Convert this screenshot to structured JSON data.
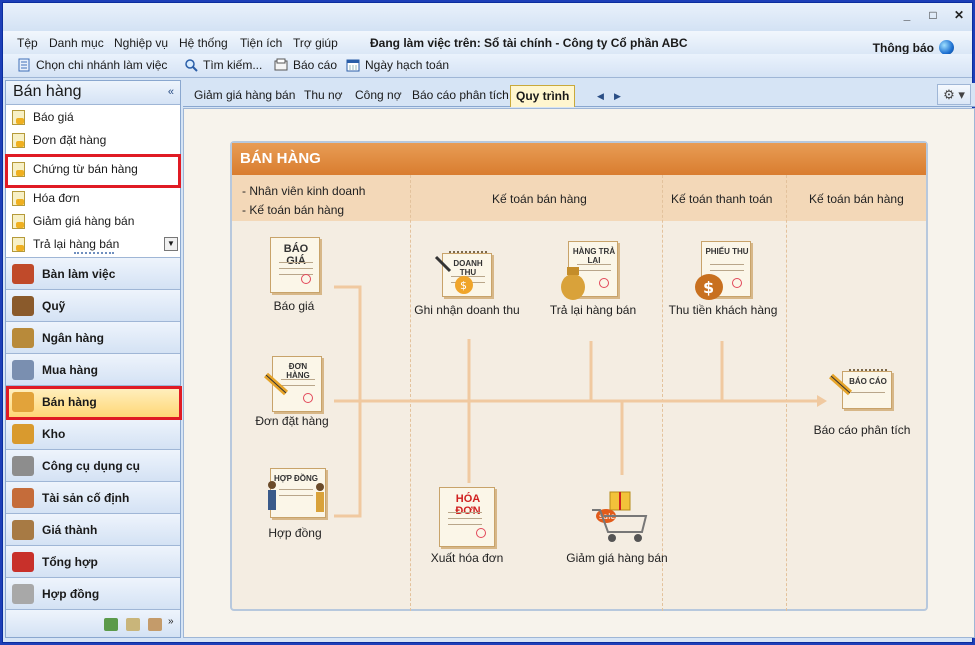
{
  "menu": {
    "items": [
      "Tệp",
      "Danh mục",
      "Nghiệp vụ",
      "Hệ thống",
      "Tiện ích",
      "Trợ giúp"
    ],
    "working_on": "Đang làm việc trên: Sổ tài chính - Công ty Cổ phần ABC",
    "notify": "Thông báo"
  },
  "toolbar": {
    "branch": "Chọn chi nhánh làm việc",
    "search": "Tìm kiếm...",
    "report": "Báo cáo",
    "posting_date": "Ngày hạch toán"
  },
  "sidebar": {
    "title": "Bán hàng",
    "collapse": "«",
    "items": [
      "Báo giá",
      "Đơn đặt hàng",
      "Chứng từ bán hàng",
      "Hóa đơn",
      "Giảm giá hàng bán",
      "Trả lại hàng bán"
    ],
    "modules": [
      "Bàn làm việc",
      "Quỹ",
      "Ngân hàng",
      "Mua hàng",
      "Bán hàng",
      "Kho",
      "Công cụ dụng cụ",
      "Tài sản cố định",
      "Giá thành",
      "Tổng hợp",
      "Hợp đồng"
    ],
    "active_module": "Bán hàng"
  },
  "tabs": [
    "Giảm giá hàng bán",
    "Thu nợ",
    "Công nợ",
    "Báo cáo phân tích",
    "Quy trình"
  ],
  "active_tab": "Quy trình",
  "process": {
    "title": "BÁN HÀNG",
    "roles": [
      "- Nhân viên kinh doanh",
      "- Kế toán bán hàng"
    ],
    "columns": [
      "Kế toán bán hàng",
      "Kế toán thanh toán",
      "Kế toán bán hàng"
    ],
    "docs": {
      "quote": "BÁO GIÁ",
      "order": "ĐƠN HÀNG",
      "contract": "HỢP ĐỒNG",
      "revenue": "DOANH THU",
      "returns": "HÀNG TRẢ LẠI",
      "receipt": "PHIẾU THU",
      "invoice": "HÓA ĐƠN",
      "report": "BÁO CÁO",
      "sale": "sale"
    },
    "steps": {
      "quote": "Báo giá",
      "order": "Đơn đặt hàng",
      "contract": "Hợp đồng",
      "revenue": "Ghi nhận doanh thu",
      "returns": "Trả lại hàng bán",
      "receipt": "Thu tiền khách hàng",
      "invoice": "Xuất hóa đơn",
      "discount": "Giảm giá hàng bán",
      "analysis": "Báo cáo phân tích"
    }
  },
  "colors": {
    "accent": "#d97d2f",
    "highlight": "#e01b24",
    "flow": "#f0c9a0"
  }
}
